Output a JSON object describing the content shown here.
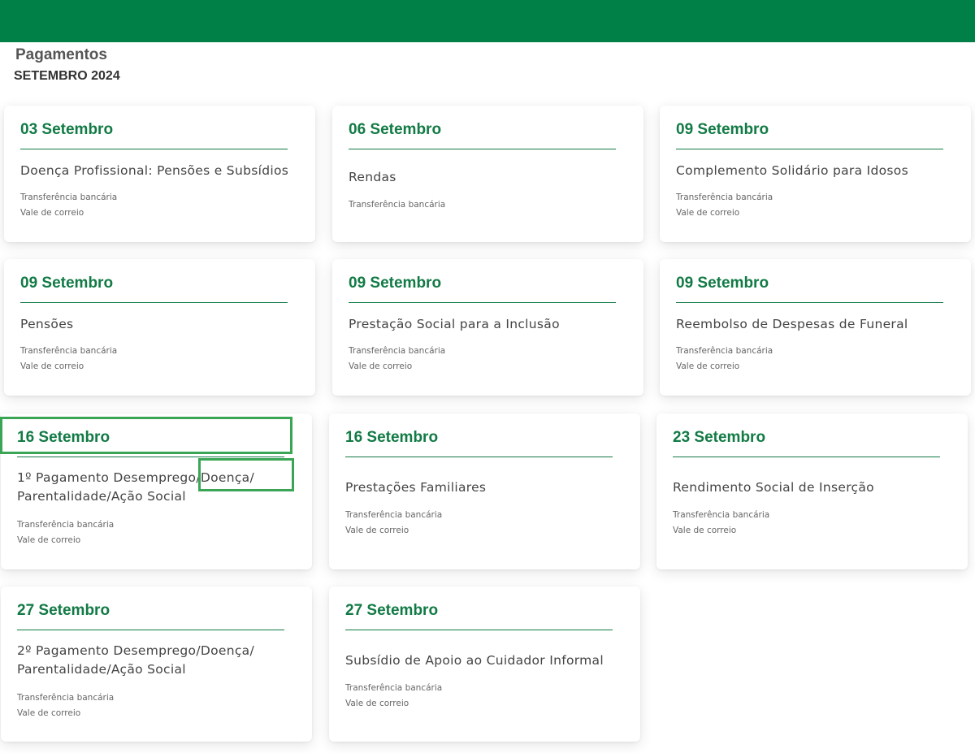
{
  "header": {
    "title": "Pagamentos",
    "subtitle": "SETEMBRO 2024",
    "bar_color": "#007f46"
  },
  "accent_color": "#127a45",
  "cards": [
    {
      "date": "03 Setembro",
      "title": "Doença Profissional: Pensões e Subsídios",
      "methods": [
        "Transferência bancária",
        "Vale de correio"
      ]
    },
    {
      "date": "06 Setembro",
      "title": "Rendas",
      "methods": [
        "Transferência bancária"
      ]
    },
    {
      "date": "09 Setembro",
      "title": "Complemento Solidário para Idosos",
      "methods": [
        "Transferência bancária",
        "Vale de correio"
      ]
    },
    {
      "date": "09 Setembro",
      "title": "Pensões",
      "methods": [
        "Transferência bancária",
        "Vale de correio"
      ]
    },
    {
      "date": "09 Setembro",
      "title": "Prestação Social para a Inclusão",
      "methods": [
        "Transferência bancária",
        "Vale de correio"
      ]
    },
    {
      "date": "09 Setembro",
      "title": "Reembolso de Despesas de Funeral",
      "methods": [
        "Transferência bancária",
        "Vale de correio"
      ]
    },
    {
      "date": "16 Setembro",
      "title_lines": [
        "1º Pagamento Desemprego/Doença/",
        "Parentalidade/Ação Social"
      ],
      "methods": [
        "Transferência bancária",
        "Vale de correio"
      ]
    },
    {
      "date": "16 Setembro",
      "title": "Prestações Familiares",
      "methods": [
        "Transferência bancária",
        "Vale de correio"
      ]
    },
    {
      "date": "23 Setembro",
      "title": "Rendimento Social de Inserção",
      "methods": [
        "Transferência bancária",
        "Vale de correio"
      ]
    },
    {
      "date": "27 Setembro",
      "title_lines": [
        "2º Pagamento Desemprego/Doença/",
        "Parentalidade/Ação Social"
      ],
      "methods": [
        "Transferência bancária",
        "Vale de correio"
      ]
    },
    {
      "date": "27 Setembro",
      "title": "Subsídio de Apoio ao Cuidador Informal",
      "methods": [
        "Transferência bancária",
        "Vale de correio"
      ]
    }
  ]
}
